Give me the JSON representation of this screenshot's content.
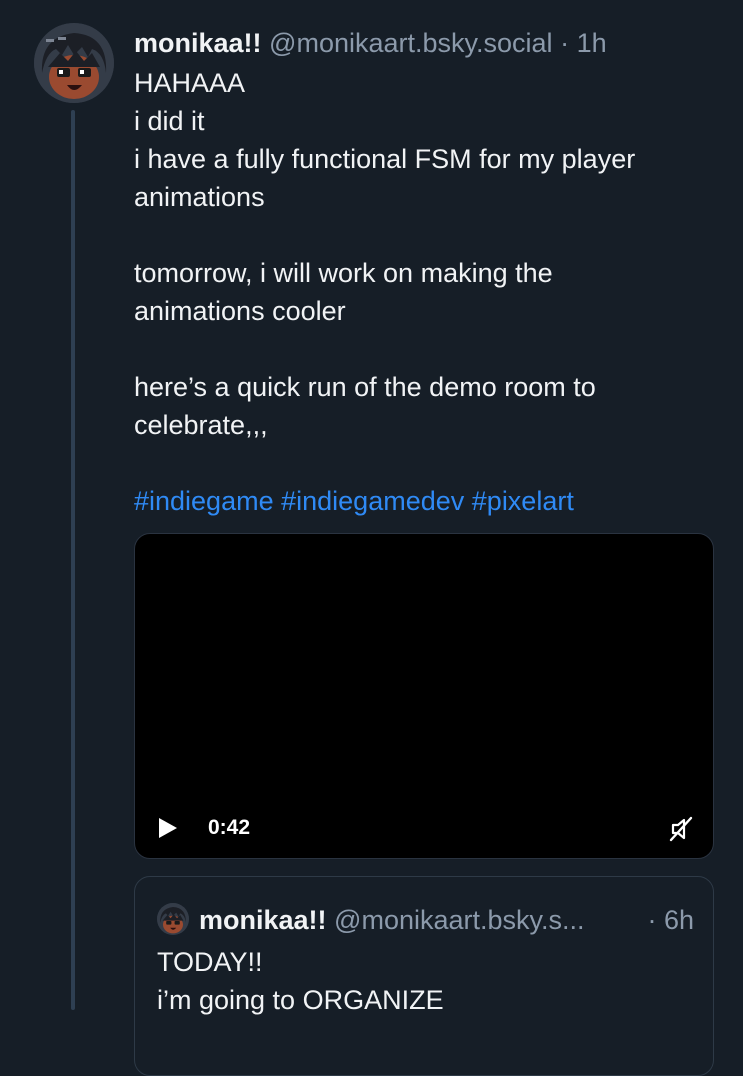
{
  "post": {
    "author_name": "monikaa!!",
    "author_handle": "@monikaart.bsky.social",
    "separator": "·",
    "time": "1h",
    "body_lines": [
      "HAHAAA",
      "i did it",
      "i have a fully functional FSM for my player",
      "animations",
      "",
      "tomorrow, i will work on making the",
      "animations cooler",
      "",
      "here’s a quick run of the demo room to",
      "celebrate,,,",
      ""
    ],
    "hashtags": [
      "#indiegame",
      "#indiegamedev",
      "#pixelart"
    ],
    "video": {
      "duration": "0:42",
      "play_icon": "play-icon",
      "mute_icon": "muted-speaker-icon"
    }
  },
  "quote": {
    "author_name": "monikaa!!",
    "author_handle": "@monikaart.bsky.s...",
    "separator": "·",
    "time": "6h",
    "body_lines": [
      "TODAY!!",
      "i’m going to ORGANIZE"
    ]
  },
  "colors": {
    "background": "#161e27",
    "text": "#f1f3f5",
    "muted": "#8c9aab",
    "link": "#2f8af5",
    "thread_line": "#2e3f52"
  }
}
